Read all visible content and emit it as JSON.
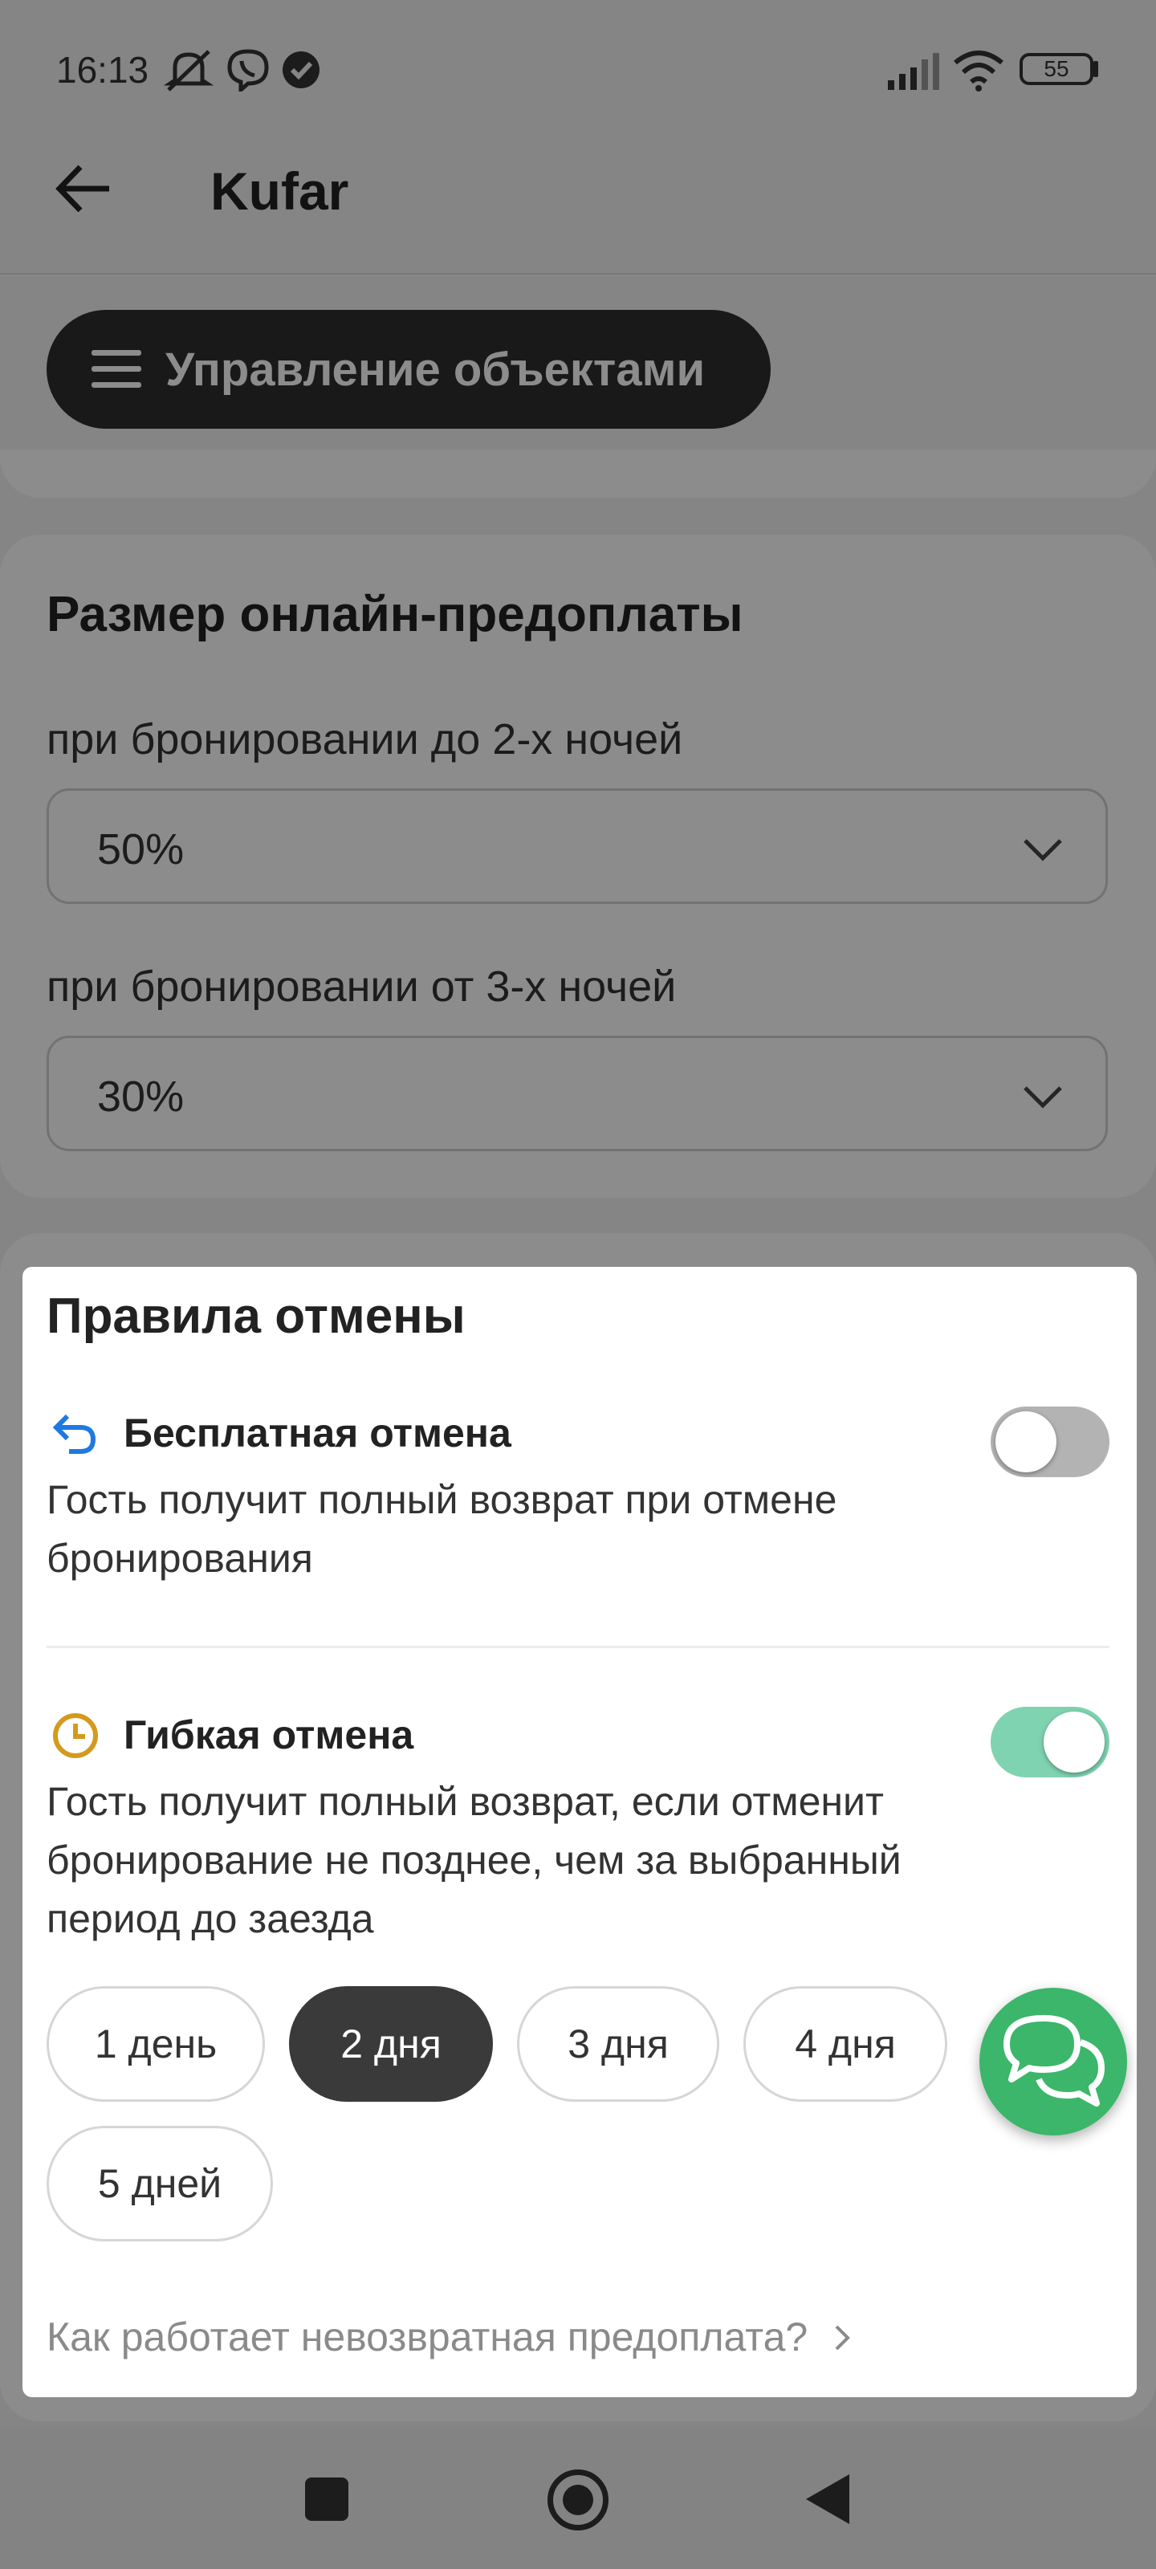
{
  "status_bar": {
    "time": "16:13",
    "battery": "55",
    "icons": [
      "mute-icon",
      "viber-icon",
      "check-badge-icon",
      "signal-icon",
      "wifi-icon",
      "battery-icon"
    ]
  },
  "app_bar": {
    "title": "Kufar",
    "back_icon": "arrow-left-icon"
  },
  "manage_button": {
    "label": "Управление объектами",
    "icon": "menu-icon"
  },
  "prepayment": {
    "title": "Размер онлайн-предоплаты",
    "short_stay": {
      "label": "при бронировании до 2-х ночей",
      "value": "50%"
    },
    "long_stay": {
      "label": "при бронировании от 3-х ночей",
      "value": "30%"
    }
  },
  "cancellation_sheet": {
    "title": "Правила отмены",
    "free": {
      "icon": "undo-arrow-icon",
      "title": "Бесплатная отмена",
      "description": "Гость получит полный возврат при отмене бронирования",
      "enabled": false
    },
    "flexible": {
      "icon": "clock-icon",
      "title": "Гибкая отмена",
      "description": "Гость получит полный возврат, если отменит бронирование не позднее, чем за выбранный период до заезда",
      "enabled": true
    },
    "periods": [
      "1 день",
      "2 дня",
      "3 дня",
      "4 дня",
      "5 дней"
    ],
    "selected_period": "2 дня",
    "link": "Как работает невозвратная предоплата?"
  },
  "colors": {
    "accent_green": "#3bb66a",
    "toggle_on": "#7fd3b1",
    "free_icon_blue": "#1f7ae0",
    "flexible_icon_amber": "#d49a1c",
    "dark_pill": "#2f2f2f"
  },
  "nav_bar": {
    "icons": [
      "recents-square-icon",
      "home-circle-icon",
      "back-triangle-icon"
    ]
  }
}
